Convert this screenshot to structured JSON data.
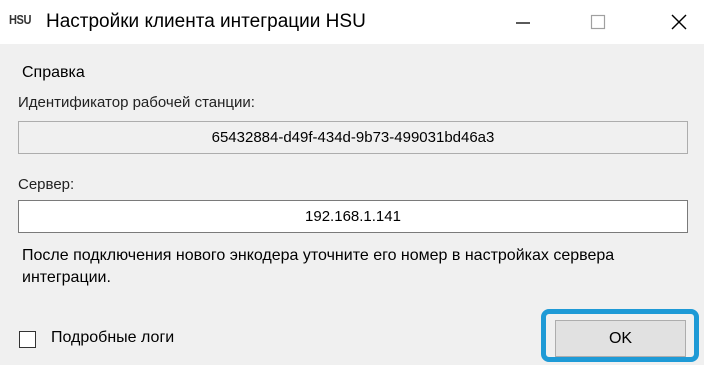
{
  "window": {
    "app_icon_text": "HSU",
    "title": "Настройки клиента интеграции HSU",
    "controls": {
      "minimize_icon": "minimize-icon",
      "maximize_icon": "maximize-icon",
      "close_icon": "close-icon"
    }
  },
  "menu": {
    "items": [
      {
        "label": "Справка"
      }
    ]
  },
  "workstation": {
    "label": "Идентификатор рабочей станции:",
    "value": "65432884-d49f-434d-9b73-499031bd46a3"
  },
  "server": {
    "label": "Сервер:",
    "value": "192.168.1.141"
  },
  "hint": "После подключения нового энкодера уточните его номер в настройках сервера интеграции.",
  "verbose_logs": {
    "label": "Подробные логи",
    "checked": false
  },
  "ok_button": {
    "label": "OK",
    "highlight_color": "#1e9ad6"
  }
}
